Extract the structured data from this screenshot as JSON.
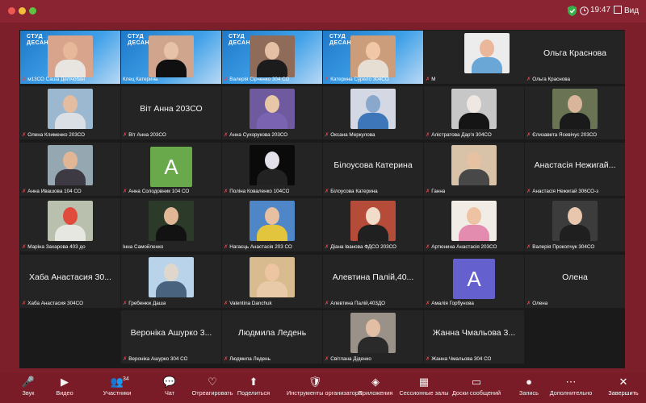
{
  "titlebar": {
    "time": "19:47",
    "view_label": "Вид"
  },
  "gallery": {
    "tiles": [
      {
        "name": "м13СО Саша Делічобан",
        "muted": true,
        "type": "photo",
        "banner": "СТУД\nДЕСАНТ",
        "bg": "#d8a58c",
        "body": "#e8e4e0",
        "head": "#e7b89a"
      },
      {
        "name": "Клец Катерина",
        "muted": false,
        "type": "photo",
        "banner": "СТУД\nДЕСАНТ",
        "bg": "#cfa58e",
        "body": "#101010",
        "head": "#e8c2a8",
        "active": true
      },
      {
        "name": "Валерія Сірченко 304 СО",
        "muted": true,
        "type": "photo",
        "banner": "СТУД\nДЕСАНТ",
        "bg": "#8f6b5a",
        "body": "#1c1c1c",
        "head": "#e5c0a5"
      },
      {
        "name": "Катерина Сурело 304СО",
        "muted": true,
        "type": "photo",
        "banner": "СТУД\nДЕСАНТ",
        "bg": "#cc9d7a",
        "body": "#e6ddd3",
        "head": "#f0c8a8"
      },
      {
        "name": "М",
        "muted": true,
        "type": "empty"
      },
      {
        "name": "",
        "muted": false,
        "type": "photo",
        "bg": "#ececec",
        "body": "#6aa7d6",
        "head": "#eab79b"
      },
      {
        "name": "Ольга Краснова",
        "muted": true,
        "type": "name"
      },
      {
        "name": "Олена Клименко 203СО",
        "muted": true,
        "type": "photo",
        "bg": "#9cb7d0",
        "body": "#d9dfe4",
        "head": "#e4bca0"
      },
      {
        "name": "Віт Анна 203СО",
        "muted": true,
        "type": "name"
      },
      {
        "name": "Анна Сухорукова 203СО",
        "muted": true,
        "type": "photo",
        "bg": "#6f5aa0",
        "body": "#7a63b0",
        "head": "#e8c7a6"
      },
      {
        "name": "Оксана Меркулова",
        "muted": true,
        "type": "photo",
        "bg": "#d4d8e4",
        "body": "#3d77b9",
        "head": "#8aa8cc"
      },
      {
        "name": "Алістратова Дар'я 304СО",
        "muted": true,
        "type": "photo",
        "bg": "#c7c7c7",
        "body": "#151515",
        "head": "#efe8e2"
      },
      {
        "name": "Єлизавета Ясевічус 203СО",
        "muted": true,
        "type": "photo",
        "bg": "#6a7454",
        "body": "#1a1a1a",
        "head": "#d9b59b"
      },
      {
        "name": "Анна Ивашова 104 СО",
        "muted": true,
        "type": "photo",
        "bg": "#95a8b2",
        "body": "#3d3a44",
        "head": "#e2b694"
      },
      {
        "name": "Анна Солодовник 104 СО",
        "muted": true,
        "type": "avatar",
        "letter": "A",
        "color": "#6aa94b"
      },
      {
        "name": "Поліна Коваленко 104СО",
        "muted": true,
        "type": "photo",
        "bg": "#0a0a0a",
        "body": "#222222",
        "head": "#e4e0ea"
      },
      {
        "name": "Білоусова Катерина",
        "muted": true,
        "type": "name"
      },
      {
        "name": "Ганна",
        "muted": true,
        "type": "photo",
        "bg": "#d8c3a8",
        "body": "#484848",
        "head": "#e6c2a2"
      },
      {
        "name": "Анастасія Нежигай 306СО-з",
        "muted": true,
        "type": "name"
      },
      {
        "name": "Маріна Захарова 403 до",
        "muted": true,
        "type": "photo",
        "bg": "#b9c0ae",
        "body": "#e7e7e2",
        "head": "#e04b3c"
      },
      {
        "name": "Інна Самойленко",
        "muted": false,
        "type": "photo",
        "bg": "#2c3a2a",
        "body": "#121212",
        "head": "#e0b896"
      },
      {
        "name": "Нагаєць Анастасія 203 СО",
        "muted": true,
        "type": "photo",
        "bg": "#4f86c8",
        "body": "#e2c43d",
        "head": "#e6c0a0"
      },
      {
        "name": "Діана Іванова ФДСО 203СО",
        "muted": true,
        "type": "photo",
        "bg": "#b54c3a",
        "body": "#202020",
        "head": "#f0dcc8"
      },
      {
        "name": "Артюнина Анастасія 203СО",
        "muted": true,
        "type": "photo",
        "bg": "#f1ede6",
        "body": "#e48bb0",
        "head": "#eec3a3"
      },
      {
        "name": "Валерія Прокопчук 304СО",
        "muted": true,
        "type": "photo",
        "bg": "#3c3c3c",
        "body": "#1f1f1f",
        "head": "#e8c6ae"
      },
      {
        "name": "Хаба Анастасия 304СО",
        "muted": true,
        "type": "name"
      },
      {
        "name": "Гребенюк Даша",
        "muted": true,
        "type": "photo",
        "bg": "#b9d3ea",
        "body": "#49627d",
        "head": "#dfd6cc"
      },
      {
        "name": "Valentina Danchuk",
        "muted": true,
        "type": "photo",
        "bg": "#d8bb8f",
        "body": "#e8c9a8",
        "head": "#eec5a2"
      },
      {
        "name": "Алевтина Палій,403ДО",
        "muted": true,
        "type": "name"
      },
      {
        "name": "Амалія Горбунова",
        "muted": true,
        "type": "avatar",
        "letter": "A",
        "color": "#6461cf"
      },
      {
        "name": "Олена",
        "muted": true,
        "type": "name"
      },
      {
        "name": "Вероніка Ашурко 304 СО",
        "muted": true,
        "type": "name"
      },
      {
        "name": "Людмила Ледень",
        "muted": true,
        "type": "name"
      },
      {
        "name": "Світлана Діденко",
        "muted": true,
        "type": "photo",
        "bg": "#9a9288",
        "body": "#2a2a2a",
        "head": "#e2bfa4"
      },
      {
        "name": "Жанна Чмальова 304 СО",
        "muted": true,
        "type": "name"
      }
    ],
    "big_names": {
      "6": "Ольга Краснова",
      "8": "Віт Анна 203СО",
      "16": "Білоусова Катерина",
      "18": "Анастасія Нежигай...",
      "25": "Хаба Анастасия 30...",
      "28": "Алевтина Палій,40...",
      "30": "Олена",
      "31": "Вероніка Ашурко 3...",
      "32": "Людмила Ледень",
      "34": "Жанна Чмальова 3..."
    }
  },
  "toolbar": {
    "items": [
      {
        "label": "Звук",
        "icon": "🎤"
      },
      {
        "label": "Видео",
        "icon": "▶"
      },
      {
        "label": "Участники",
        "icon": "👥",
        "badge": "34"
      },
      {
        "label": "Чат",
        "icon": "💬"
      },
      {
        "label": "Отреагировать",
        "icon": "♡"
      },
      {
        "label": "Поделиться",
        "icon": "⬆"
      },
      {
        "label": "Инструменты организатора",
        "icon": "🛡"
      },
      {
        "label": "Приложения",
        "icon": "◈"
      },
      {
        "label": "Сессионные залы",
        "icon": "▦"
      },
      {
        "label": "Доски сообщений",
        "icon": "▭"
      },
      {
        "label": "Запись",
        "icon": "●"
      },
      {
        "label": "Дополнительно",
        "icon": "⋯"
      }
    ],
    "end_label": "Завершить",
    "end_icon": "✕"
  }
}
